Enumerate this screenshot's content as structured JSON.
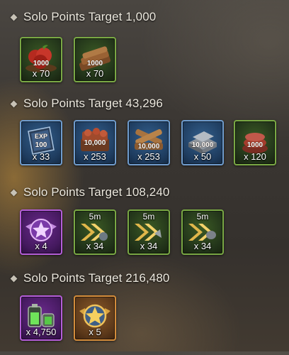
{
  "sections": [
    {
      "title": "Solo Points Target 1,000",
      "items": [
        {
          "icon": "food-icon",
          "art_label": "1000",
          "qty": "x 70",
          "rarity": "green"
        },
        {
          "icon": "wood-icon",
          "art_label": "1000",
          "qty": "x 70",
          "rarity": "green"
        }
      ]
    },
    {
      "title": "Solo Points Target 43,296",
      "items": [
        {
          "icon": "exp-book-icon",
          "art_label": "100",
          "art_label_top": "EXP",
          "qty": "x 33",
          "rarity": "blue"
        },
        {
          "icon": "food-icon",
          "art_label": "10,000",
          "qty": "x 253",
          "rarity": "blue"
        },
        {
          "icon": "wood-icon",
          "art_label": "10,000",
          "qty": "x 253",
          "rarity": "blue"
        },
        {
          "icon": "steel-icon",
          "art_label": "10,000",
          "qty": "x 50",
          "rarity": "blue"
        },
        {
          "icon": "food-icon",
          "art_label": "1000",
          "qty": "x 120",
          "rarity": "green"
        }
      ]
    },
    {
      "title": "Solo Points Target 108,240",
      "items": [
        {
          "icon": "rank-emblem-icon",
          "qty": "x 4",
          "rarity": "purple"
        },
        {
          "icon": "speedup-icon",
          "duration": "5m",
          "qty": "x 34",
          "rarity": "green"
        },
        {
          "icon": "speedup-icon",
          "duration": "5m",
          "qty": "x 34",
          "rarity": "green"
        },
        {
          "icon": "speedup-icon",
          "duration": "5m",
          "qty": "x 34",
          "rarity": "green"
        }
      ]
    },
    {
      "title": "Solo Points Target 216,480",
      "items": [
        {
          "icon": "battery-icon",
          "qty": "x 4,750",
          "rarity": "purple"
        },
        {
          "icon": "gold-star-emblem-icon",
          "qty": "x 5",
          "rarity": "gold"
        }
      ]
    }
  ]
}
